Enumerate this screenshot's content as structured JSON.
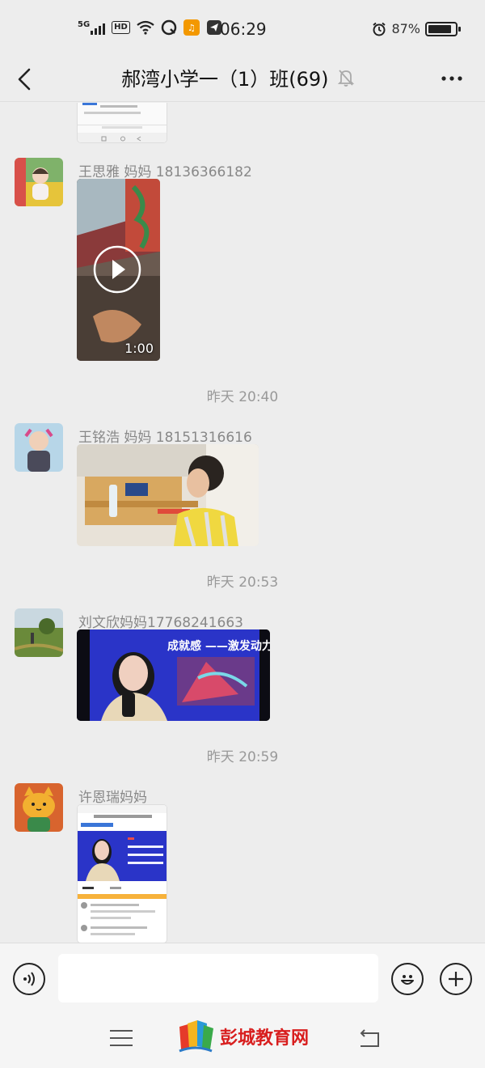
{
  "status_bar": {
    "network": "5G",
    "hd": "HD",
    "time": "06:29",
    "battery_text": "87%",
    "battery_level": 0.87
  },
  "header": {
    "title": "郝湾小学一（1）班(69)",
    "back_icon": "chevron-left-icon",
    "mute_icon": "bell-off-icon",
    "more_icon": "more-icon"
  },
  "messages": [
    {
      "sender": "王思雅 妈妈 18136366182",
      "type": "video",
      "duration": "1:00"
    },
    {
      "timestamp": "昨天 20:40"
    },
    {
      "sender": "王铭浩 妈妈 18151316616",
      "type": "image"
    },
    {
      "timestamp": "昨天 20:53"
    },
    {
      "sender": "刘文欣妈妈17768241663",
      "type": "image",
      "slide_title": "成就感 ——激发动力"
    },
    {
      "timestamp": "昨天 20:59"
    },
    {
      "sender": "许恩瑞妈妈",
      "type": "image"
    }
  ],
  "input_bar": {
    "placeholder": "",
    "voice_icon": "voice-icon",
    "emoji_icon": "emoji-icon",
    "plus_icon": "plus-icon"
  },
  "watermark": {
    "text": "彭城教育网"
  }
}
